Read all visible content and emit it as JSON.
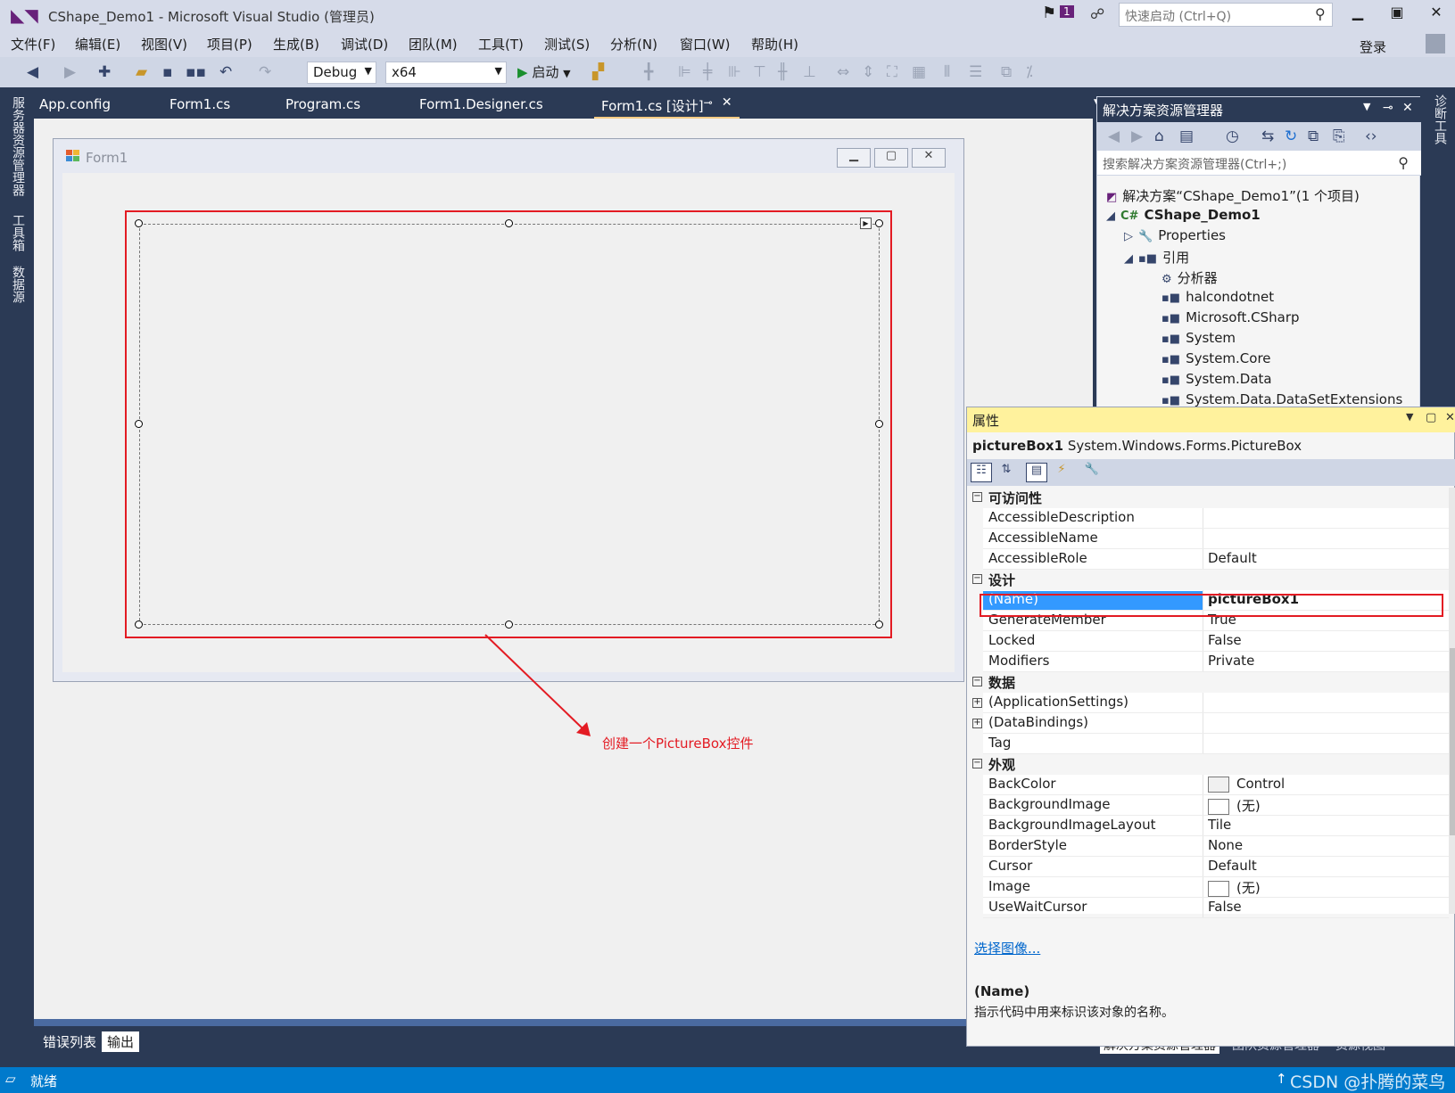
{
  "window": {
    "title": "CShape_Demo1 - Microsoft Visual Studio (管理员)",
    "notification_count": "1",
    "quick_launch_placeholder": "快速启动 (Ctrl+Q)",
    "login": "登录"
  },
  "menu": [
    "文件(F)",
    "编辑(E)",
    "视图(V)",
    "项目(P)",
    "生成(B)",
    "调试(D)",
    "团队(M)",
    "工具(T)",
    "测试(S)",
    "分析(N)",
    "窗口(W)",
    "帮助(H)"
  ],
  "toolbar": {
    "configuration": "Debug",
    "platform": "x64",
    "start_label": "启动"
  },
  "left_tabs": [
    "服务器资源管理器",
    "工具箱",
    "数据源"
  ],
  "right_tabs": [
    "诊断工具"
  ],
  "doc_tabs": [
    "App.config",
    "Form1.cs",
    "Program.cs",
    "Form1.Designer.cs",
    "Form1.cs [设计]"
  ],
  "designer": {
    "form_title": "Form1",
    "annotation": "创建一个PictureBox控件"
  },
  "bottom_tabs": [
    "错误列表",
    "输出"
  ],
  "status": {
    "text": "就绪",
    "watermark": "CSDN @扑腾的菜鸟"
  },
  "solution_explorer": {
    "title": "解决方案资源管理器",
    "search_placeholder": "搜索解决方案资源管理器(Ctrl+;)",
    "tree": [
      "解决方案“CShape_Demo1”(1 个项目)",
      "CShape_Demo1",
      "Properties",
      "引用",
      "分析器",
      "halcondotnet",
      "Microsoft.CSharp",
      "System",
      "System.Core",
      "System.Data",
      "System.Data.DataSetExtensions"
    ],
    "bottom_tabs": [
      "解决方案资源管理器",
      "团队资源管理器",
      "资源视图"
    ]
  },
  "properties": {
    "title": "属性",
    "object_name": "pictureBox1",
    "object_type": "System.Windows.Forms.PictureBox",
    "categories": {
      "accessibility": "可访问性",
      "design": "设计",
      "data": "数据",
      "appearance": "外观"
    },
    "rows": {
      "accessible_description": {
        "name": "AccessibleDescription",
        "value": ""
      },
      "accessible_name": {
        "name": "AccessibleName",
        "value": ""
      },
      "accessible_role": {
        "name": "AccessibleRole",
        "value": "Default"
      },
      "name": {
        "name": "(Name)",
        "value": "pictureBox1"
      },
      "generate_member": {
        "name": "GenerateMember",
        "value": "True"
      },
      "locked": {
        "name": "Locked",
        "value": "False"
      },
      "modifiers": {
        "name": "Modifiers",
        "value": "Private"
      },
      "application_settings": {
        "name": "(ApplicationSettings)",
        "value": ""
      },
      "data_bindings": {
        "name": "(DataBindings)",
        "value": ""
      },
      "tag": {
        "name": "Tag",
        "value": ""
      },
      "back_color": {
        "name": "BackColor",
        "value": "Control"
      },
      "background_image": {
        "name": "BackgroundImage",
        "value": "(无)"
      },
      "background_image_layout": {
        "name": "BackgroundImageLayout",
        "value": "Tile"
      },
      "border_style": {
        "name": "BorderStyle",
        "value": "None"
      },
      "cursor": {
        "name": "Cursor",
        "value": "Default"
      },
      "image": {
        "name": "Image",
        "value": "(无)"
      },
      "use_wait_cursor": {
        "name": "UseWaitCursor",
        "value": "False"
      }
    },
    "choose_image_link": "选择图像...",
    "description_title": "(Name)",
    "description_text": "指示代码中用来标识该对象的名称。"
  },
  "colors": {
    "accent": "#007acc",
    "highlight_red": "#e31b23",
    "selection_blue": "#3399ff",
    "panel_dark": "#2b3a55",
    "properties_header": "#fff29d"
  }
}
